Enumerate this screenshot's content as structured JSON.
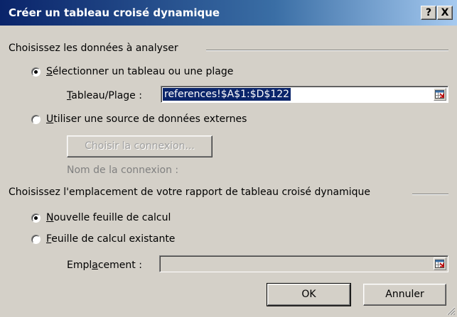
{
  "window": {
    "title": "Créer un tableau croisé dynamique",
    "help_label": "?",
    "close_label": "X"
  },
  "source_group": {
    "label": "Choisissez les données à analyser",
    "option_table": {
      "label_u": "S",
      "label_rest": "électionner un tableau ou une plage",
      "checked": true
    },
    "table_range": {
      "label_u": "T",
      "label_rest": "ableau/Plage :",
      "value": "references!$A$1:$D$122"
    },
    "option_external": {
      "label_u": "U",
      "label_rest": "tiliser une source de données externes",
      "checked": false
    },
    "choose_connection_label": "Choisir la connexion...",
    "connection_name_label": "Nom de la connexion :"
  },
  "location_group": {
    "label": "Choisissez l'emplacement de votre rapport de tableau croisé dynamique",
    "option_new_sheet": {
      "label_u": "N",
      "label_rest": "ouvelle feuille de calcul",
      "checked": true
    },
    "option_existing_sheet": {
      "label_u": "F",
      "label_rest": "euille de calcul existante",
      "checked": false
    },
    "location_field": {
      "label_pre": "Empl",
      "label_u": "a",
      "label_post": "cement :",
      "value": ""
    }
  },
  "buttons": {
    "ok": "OK",
    "cancel": "Annuler"
  }
}
